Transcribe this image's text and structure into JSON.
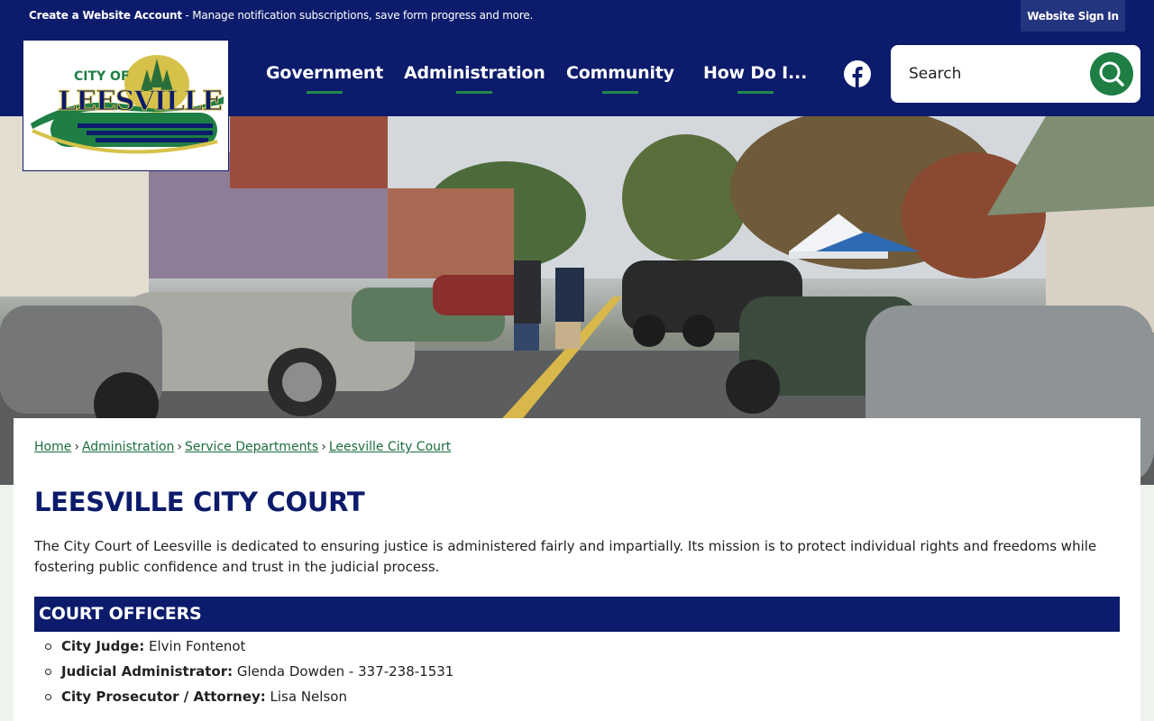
{
  "topbar": {
    "account_link": "Create a Website Account",
    "account_message": " - Manage notification subscriptions, save form progress and more.",
    "signin": "Website Sign In"
  },
  "logo": {
    "city_of": "CITY OF",
    "name": "LEESVILLE"
  },
  "nav": {
    "items": [
      {
        "label": "Government"
      },
      {
        "label": "Administration"
      },
      {
        "label": "Community"
      },
      {
        "label": "How Do I..."
      }
    ],
    "social_icon": "facebook-icon"
  },
  "search": {
    "placeholder": "Search",
    "icon": "search-icon"
  },
  "breadcrumb": {
    "items": [
      "Home",
      "Administration",
      "Service Departments",
      "Leesville City Court"
    ],
    "separator": "›"
  },
  "page": {
    "title": "LEESVILLE CITY COURT",
    "intro": "The City Court of Leesville is dedicated to ensuring justice is administered fairly and impartially. Its mission is to protect individual rights and freedoms while fostering public confidence and trust in the judicial process."
  },
  "court_officers": {
    "heading": "COURT OFFICERS",
    "items": [
      {
        "role": "City Judge:",
        "value": " Elvin Fontenot"
      },
      {
        "role": "Judicial Administrator:",
        "value": " Glenda Dowden - 337-238-1531"
      },
      {
        "role": "City Prosecutor / Attorney:",
        "value": " Lisa Nelson"
      }
    ]
  },
  "colors": {
    "navy": "#0c1b6b",
    "green": "#1e7e44",
    "link_green": "#1b6d3c"
  }
}
